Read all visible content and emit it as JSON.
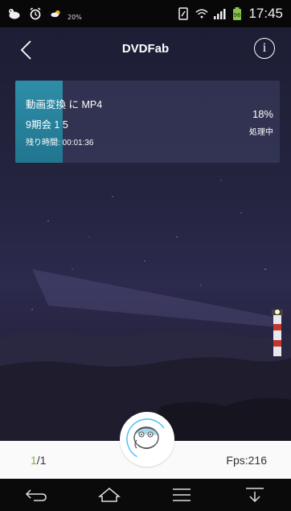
{
  "status_bar": {
    "icons": [
      "cat-icon",
      "alarm-icon",
      "weather-icon",
      "nfc-icon",
      "wifi-icon",
      "signal-icon",
      "battery-icon"
    ],
    "weather_percent": "20%",
    "time": "17:45"
  },
  "header": {
    "title": "DVDFab",
    "back_icon": "chevron-left-icon",
    "info_icon": "info-icon",
    "info_glyph": "i"
  },
  "task": {
    "line1": "動画変換 に MP4",
    "line2": "9期会 1 5",
    "line3": "残り時間: 00:01:36",
    "percent_text": "18%",
    "progress": 0.18,
    "state": "処理中",
    "progress_color": "#2b8aa6"
  },
  "bottom_bar": {
    "count_current": "1",
    "count_sep_total": "/1",
    "fps": "Fps:216",
    "accent": "#7cb342"
  },
  "nav_bar": {
    "buttons": [
      "back-icon",
      "home-icon",
      "menu-icon",
      "notification-down-icon"
    ]
  }
}
